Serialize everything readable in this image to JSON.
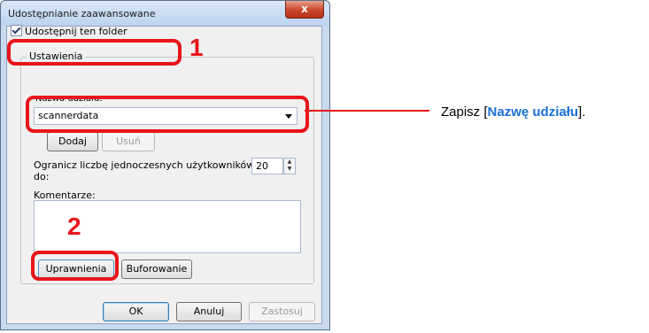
{
  "window": {
    "title": "Udostępnianie zaawansowane",
    "close_glyph": "x"
  },
  "share_checkbox": {
    "label": "Udostępnij ten folder",
    "checked": true
  },
  "settings": {
    "group_label": "Ustawienia",
    "share_name_label": "Nazwa udziału:",
    "share_name_value": "scannerdata",
    "add_button": "Dodaj",
    "remove_button": "Usuń",
    "limit_label_line1": "Ogranicz liczbę jednoczesnych użytkowników",
    "limit_label_line2": "do:",
    "limit_value": "20",
    "comments_label": "Komentarze:",
    "comments_value": "",
    "permissions_button": "Uprawnienia",
    "caching_button": "Buforowanie"
  },
  "footer": {
    "ok": "OK",
    "cancel": "Anuluj",
    "apply": "Zastosuj"
  },
  "annotations": {
    "callout_1": "1",
    "callout_2": "2",
    "note_prefix": "Zapisz [",
    "note_highlight": "Nazwę udziału",
    "note_suffix": "].",
    "accent_color": "#e8151b",
    "highlight_color": "#1a6fd6"
  }
}
